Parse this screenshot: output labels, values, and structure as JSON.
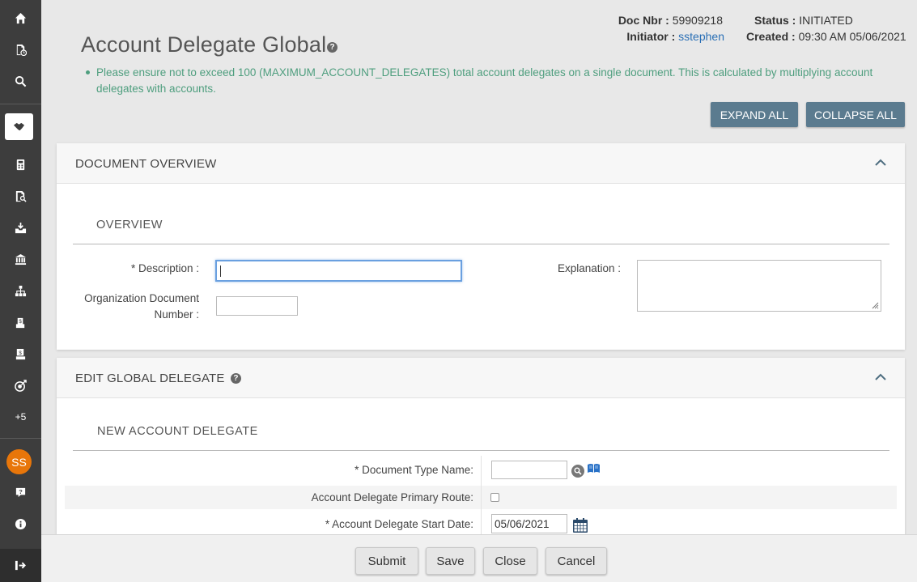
{
  "sidebar": {
    "items": [
      {
        "icon": "home-icon"
      },
      {
        "icon": "document-clock-icon"
      },
      {
        "icon": "search-icon"
      },
      {
        "icon": "handshake-icon",
        "active": true
      },
      {
        "icon": "calculator-icon"
      },
      {
        "icon": "document-search-icon"
      },
      {
        "icon": "inbox-download-icon"
      },
      {
        "icon": "bank-icon"
      },
      {
        "icon": "org-chart-icon"
      },
      {
        "icon": "sign-dollar-icon"
      },
      {
        "icon": "sign-dollar-alt-icon"
      },
      {
        "icon": "target-icon"
      }
    ],
    "more_label": "+5",
    "avatar_initials": "SS",
    "help_icon": "question-icon",
    "info_icon": "info-icon",
    "logout_icon": "logout-icon"
  },
  "header": {
    "title": "Account Delegate Global",
    "doc_nbr_label": "Doc Nbr :",
    "doc_nbr": "59909218",
    "status_label": "Status :",
    "status": "INITIATED",
    "initiator_label": "Initiator :",
    "initiator": "sstephen",
    "created_label": "Created :",
    "created": "09:30 AM 05/06/2021"
  },
  "notice": "Please ensure not to exceed 100 (MAXIMUM_ACCOUNT_DELEGATES) total account delegates on a single document. This is calculated by multiplying account delegates with accounts.",
  "toolbar": {
    "expand_all": "EXPAND ALL",
    "collapse_all": "COLLAPSE ALL"
  },
  "document_overview": {
    "title": "DOCUMENT OVERVIEW",
    "section": "OVERVIEW",
    "description_label": "* Description :",
    "description_value": "",
    "org_doc_label_line1": "Organization Document",
    "org_doc_label_line2": "Number :",
    "org_doc_value": "",
    "explanation_label": "Explanation :",
    "explanation_value": ""
  },
  "edit_global_delegate": {
    "title": "EDIT GLOBAL DELEGATE",
    "section": "NEW ACCOUNT DELEGATE",
    "doc_type_label": "* Document Type Name:",
    "doc_type_value": "",
    "primary_route_label": "Account Delegate Primary Route:",
    "primary_route_checked": false,
    "start_date_label": "* Account Delegate Start Date:",
    "start_date_value": "05/06/2021"
  },
  "footer": {
    "submit": "Submit",
    "save": "Save",
    "close": "Close",
    "cancel": "Cancel"
  },
  "colors": {
    "sidebar": "#3d3d3d",
    "accent_button": "#5b7b8f",
    "notice_text": "#4e9e7e",
    "avatar": "#e8760a",
    "link": "#2a6fb5"
  }
}
